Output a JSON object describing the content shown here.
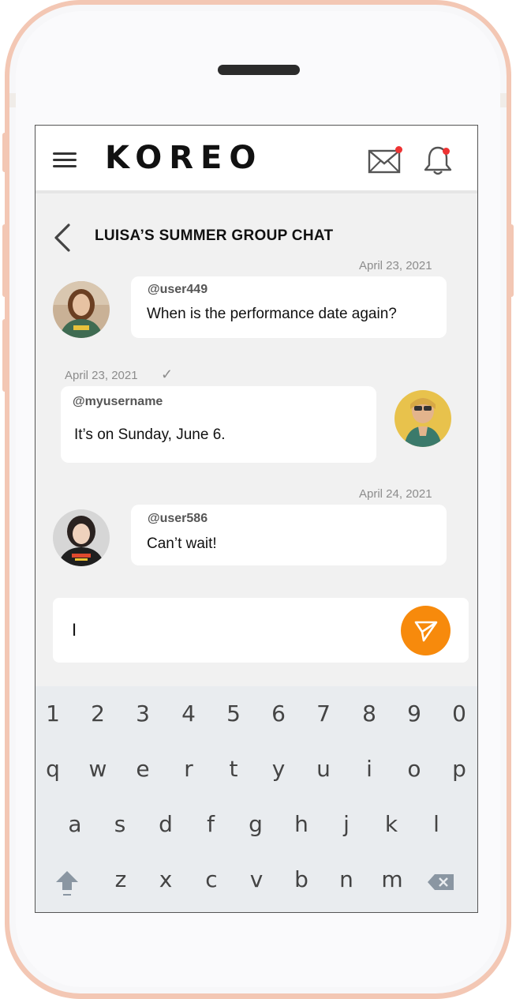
{
  "app": {
    "logo": "KOREO"
  },
  "header": {
    "menu_icon": "hamburger-menu-icon",
    "mail_icon": "envelope-icon",
    "bell_icon": "bell-icon",
    "notification_color": "#e33333"
  },
  "chat": {
    "title": "LUISA’S SUMMER GROUP CHAT",
    "back_icon": "chevron-left-icon",
    "messages": [
      {
        "timestamp": "April 23, 2021",
        "username": "@user449",
        "text": "When is the performance date again?"
      },
      {
        "timestamp": "April 23, 2021",
        "status": "✓",
        "username": "@myusername",
        "text": "It’s on Sunday, June 6."
      },
      {
        "timestamp": "April 24, 2021",
        "username": "@user586",
        "text": "Can’t wait!"
      }
    ]
  },
  "composer": {
    "value": "I",
    "send_icon": "paper-plane-icon",
    "send_color": "#f78a0c"
  },
  "keyboard": {
    "row1": [
      "1",
      "2",
      "3",
      "4",
      "5",
      "6",
      "7",
      "8",
      "9",
      "0"
    ],
    "row2": [
      "q",
      "w",
      "e",
      "r",
      "t",
      "y",
      "u",
      "i",
      "o",
      "p"
    ],
    "row3": [
      "a",
      "s",
      "d",
      "f",
      "g",
      "h",
      "j",
      "k",
      "l"
    ],
    "row4": [
      "z",
      "x",
      "c",
      "v",
      "b",
      "n",
      "m"
    ],
    "shift_icon": "shift-arrow-icon",
    "backspace_icon": "backspace-icon"
  }
}
